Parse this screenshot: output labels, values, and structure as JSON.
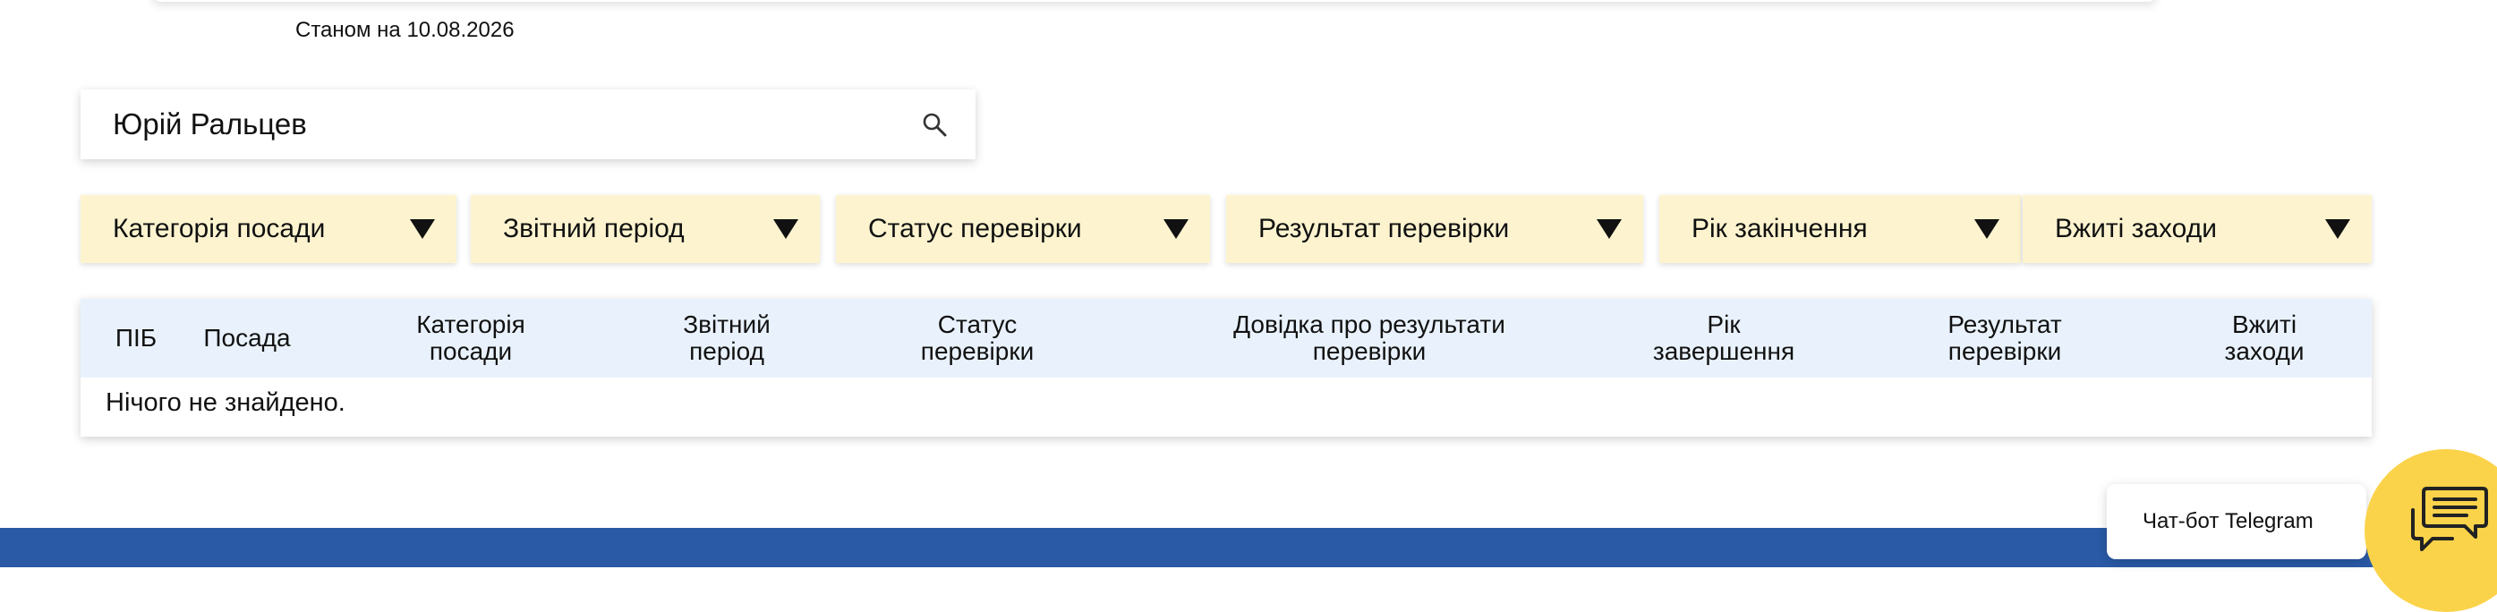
{
  "header": {
    "as_of": "Станом на 10.08.2026"
  },
  "search": {
    "value": "Юрій Ральцев",
    "icon": "search-icon"
  },
  "filters": [
    {
      "label": "Категорія посади"
    },
    {
      "label": "Звітний період"
    },
    {
      "label": "Статус перевірки"
    },
    {
      "label": "Результат перевірки"
    },
    {
      "label": "Рік закінчення"
    },
    {
      "label": "Вжиті заходи"
    }
  ],
  "table": {
    "columns": [
      {
        "line1": "ПІБ",
        "line2": ""
      },
      {
        "line1": "Посада",
        "line2": ""
      },
      {
        "line1": "Категорія",
        "line2": "посади"
      },
      {
        "line1": "Звітний",
        "line2": "період"
      },
      {
        "line1": "Статус",
        "line2": "перевірки"
      },
      {
        "line1": "Довідка про результати",
        "line2": "перевірки"
      },
      {
        "line1": "Рік",
        "line2": "завершення"
      },
      {
        "line1": "Результат",
        "line2": "перевірки"
      },
      {
        "line1": "Вжиті",
        "line2": "заходи"
      }
    ],
    "empty_message": "Нічого не знайдено."
  },
  "chat": {
    "label": "Чат-бот Telegram",
    "icon": "chat-bubbles-icon"
  },
  "colors": {
    "filter_bg": "#fdf4cf",
    "table_header_bg": "#e9f2fc",
    "footer_band": "#2a5aa6",
    "chat_fab": "#fbd34a"
  }
}
